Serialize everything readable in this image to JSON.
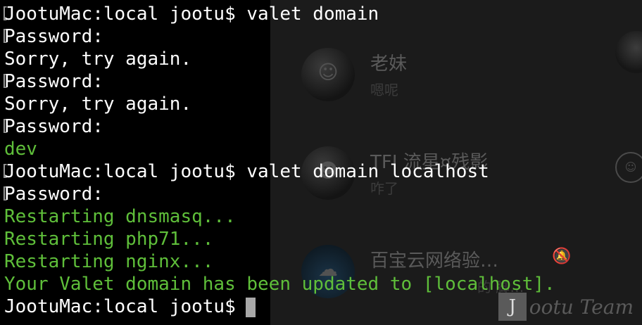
{
  "chat": {
    "items": [
      {
        "name": "老妹",
        "preview": "嗯呢"
      },
      {
        "name": "TFI 流星¤残影",
        "preview": "咋了"
      },
      {
        "name": "百宝云网络验…",
        "preview": "的 脚…"
      }
    ]
  },
  "terminal": {
    "lines": [
      {
        "marker": "[",
        "text": "JootuMac:local jootu$ valet domain",
        "color": "white"
      },
      {
        "marker": "[",
        "text": "Password:",
        "color": "white"
      },
      {
        "marker": "",
        "text": "Sorry, try again.",
        "color": "white"
      },
      {
        "marker": "[",
        "text": "Password:",
        "color": "white"
      },
      {
        "marker": "",
        "text": "Sorry, try again.",
        "color": "white"
      },
      {
        "marker": "[",
        "text": "Password:",
        "color": "white"
      },
      {
        "marker": "",
        "text": "dev",
        "color": "green"
      },
      {
        "marker": "[",
        "text": "JootuMac:local jootu$ valet domain localhost",
        "color": "white"
      },
      {
        "marker": "[",
        "text": "Password:",
        "color": "white"
      },
      {
        "marker": "",
        "text": "Restarting dnsmasq...",
        "color": "green"
      },
      {
        "marker": "",
        "text": "Restarting php71...",
        "color": "green"
      },
      {
        "marker": "",
        "text": "Restarting nginx...",
        "color": "green"
      },
      {
        "marker": "",
        "text": "Your Valet domain has been updated to [localhost].",
        "color": "green"
      },
      {
        "marker": "",
        "text": "JootuMac:local jootu$",
        "color": "white"
      }
    ]
  },
  "watermark": {
    "letter": "J",
    "text": "ootu Team"
  },
  "colors": {
    "green": "#5fbf3a",
    "white": "#ffffff"
  },
  "icons": {
    "smile": "smile-icon",
    "mute": "mute-icon"
  }
}
